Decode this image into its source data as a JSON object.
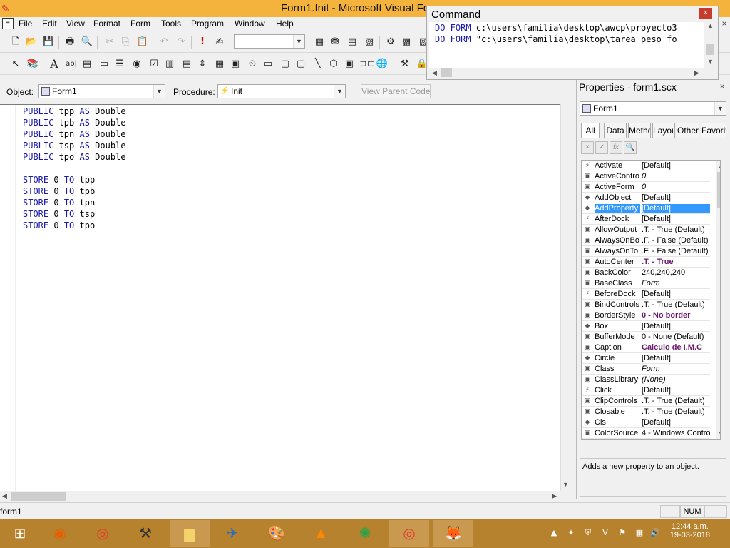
{
  "window": {
    "title": "Form1.Init - Microsoft Visual Fo"
  },
  "menu": [
    "File",
    "Edit",
    "View",
    "Format",
    "Form",
    "Tools",
    "Program",
    "Window",
    "Help"
  ],
  "object_label": "Object:",
  "object_value": "Form1",
  "procedure_label": "Procedure:",
  "procedure_value": "Init",
  "view_parent_button": "View Parent Code",
  "code_lines": [
    [
      "PUBLIC",
      " tpp ",
      "AS",
      " Double"
    ],
    [
      "PUBLIC",
      " tpb ",
      "AS",
      " Double"
    ],
    [
      "PUBLIC",
      " tpn ",
      "AS",
      " Double"
    ],
    [
      "PUBLIC",
      " tsp ",
      "AS",
      " Double"
    ],
    [
      "PUBLIC",
      " tpo ",
      "AS",
      " Double"
    ],
    [],
    [
      "STORE",
      " 0 ",
      "TO",
      " tpp"
    ],
    [
      "STORE",
      " 0 ",
      "TO",
      " tpb"
    ],
    [
      "STORE",
      " 0 ",
      "TO",
      " tpn"
    ],
    [
      "STORE",
      " 0 ",
      "TO",
      " tsp"
    ],
    [
      "STORE",
      " 0 ",
      "TO",
      " tpo"
    ]
  ],
  "command": {
    "title": "Command",
    "close": "×",
    "lines": [
      [
        "DO FORM",
        " c:\\users\\familia\\desktop\\awcp\\proyecto3"
      ],
      [
        "DO FORM",
        " \"c:\\users\\familia\\desktop\\tarea peso fo"
      ]
    ]
  },
  "properties": {
    "title": "Properties - form1.scx",
    "object": "Form1",
    "tabs": [
      "All",
      "Data",
      "Metho",
      "Layou",
      "Other",
      "Favorit"
    ],
    "tools": [
      "×",
      "✓",
      "fx",
      "🔍"
    ],
    "rows": [
      {
        "icon": "⚡",
        "name": "Activate",
        "value": "[Default]",
        "style": ""
      },
      {
        "icon": "▣",
        "name": "ActiveContro",
        "value": "0",
        "style": "ital"
      },
      {
        "icon": "▣",
        "name": "ActiveForm",
        "value": "0",
        "style": "ital"
      },
      {
        "icon": "◆",
        "name": "AddObject",
        "value": "[Default]",
        "style": ""
      },
      {
        "icon": "◆",
        "name": "AddProperty",
        "value": "[Default]",
        "style": "",
        "selected": true
      },
      {
        "icon": "⚡",
        "name": "AfterDock",
        "value": "[Default]",
        "style": ""
      },
      {
        "icon": "▣",
        "name": "AllowOutput",
        "value": ".T. - True (Default)",
        "style": ""
      },
      {
        "icon": "▣",
        "name": "AlwaysOnBo",
        "value": ".F. - False (Default)",
        "style": ""
      },
      {
        "icon": "▣",
        "name": "AlwaysOnTo",
        "value": ".F. - False (Default)",
        "style": ""
      },
      {
        "icon": "▣",
        "name": "AutoCenter",
        "value": ".T. - True",
        "style": "bold"
      },
      {
        "icon": "▣",
        "name": "BackColor",
        "value": "240,240,240",
        "style": ""
      },
      {
        "icon": "▣",
        "name": "BaseClass",
        "value": "Form",
        "style": "ital"
      },
      {
        "icon": "⚡",
        "name": "BeforeDock",
        "value": "[Default]",
        "style": ""
      },
      {
        "icon": "▣",
        "name": "BindControls",
        "value": ".T. - True (Default)",
        "style": ""
      },
      {
        "icon": "▣",
        "name": "BorderStyle",
        "value": "0 - No border",
        "style": "bold"
      },
      {
        "icon": "◆",
        "name": "Box",
        "value": "[Default]",
        "style": ""
      },
      {
        "icon": "▣",
        "name": "BufferMode",
        "value": "0 - None (Default)",
        "style": ""
      },
      {
        "icon": "▣",
        "name": "Caption",
        "value": "Calculo de I.M.C",
        "style": "bold"
      },
      {
        "icon": "◆",
        "name": "Circle",
        "value": "[Default]",
        "style": ""
      },
      {
        "icon": "▣",
        "name": "Class",
        "value": "Form",
        "style": "ital"
      },
      {
        "icon": "▣",
        "name": "ClassLibrary",
        "value": "(None)",
        "style": "ital"
      },
      {
        "icon": "⚡",
        "name": "Click",
        "value": "[Default]",
        "style": ""
      },
      {
        "icon": "▣",
        "name": "ClipControls",
        "value": ".T. - True (Default)",
        "style": ""
      },
      {
        "icon": "▣",
        "name": "Closable",
        "value": ".T. - True (Default)",
        "style": ""
      },
      {
        "icon": "◆",
        "name": "Cls",
        "value": "[Default]",
        "style": ""
      },
      {
        "icon": "▣",
        "name": "ColorSource",
        "value": "4 - Windows Contro",
        "style": ""
      }
    ],
    "description": "Adds a new property to an object."
  },
  "status": {
    "left": "form1",
    "num": "NUM"
  },
  "taskbar": {
    "time": "12:44 a.m.",
    "date": "19-03-2018",
    "apps": [
      "windows-logo-icon",
      "firefox-icon",
      "chrome-icon",
      "tool-icon",
      "folder-icon",
      "app-icon",
      "paint-icon",
      "vlc-icon",
      "green-orb-icon",
      "chrome-icon",
      "vfp-icon"
    ]
  },
  "colors": {
    "titlebar": "#f3b33d",
    "taskbar": "#b6822e",
    "keyword": "#1a1aa8",
    "selection": "#3399ff"
  }
}
